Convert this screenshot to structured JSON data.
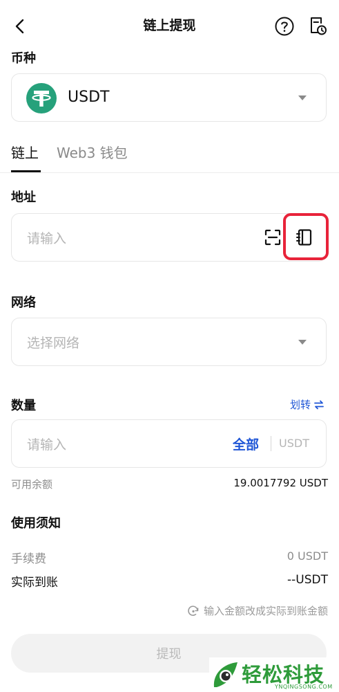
{
  "header": {
    "title": "链上提现"
  },
  "coin": {
    "label": "币种",
    "selected": "USDT"
  },
  "tabs": [
    {
      "label": "链上"
    },
    {
      "label": "Web3 钱包"
    }
  ],
  "address": {
    "label": "地址",
    "placeholder": "请输入"
  },
  "network": {
    "label": "网络",
    "placeholder": "选择网络"
  },
  "amount": {
    "label": "数量",
    "transfer_label": "划转",
    "placeholder": "请输入",
    "all_label": "全部",
    "unit": "USDT",
    "available_label": "可用余额",
    "available_value": "19.0017792 USDT"
  },
  "notice": {
    "title": "使用须知",
    "fee_label": "手续费",
    "fee_value": "0 USDT",
    "received_label": "实际到账",
    "received_value": "--USDT",
    "switch_hint": "输入金额改成实际到账金额"
  },
  "submit": {
    "label": "提现"
  },
  "watermark": {
    "brand": "轻松科技",
    "domain": "YNQINGSONG.COM"
  },
  "colors": {
    "accent": "#1f56d6",
    "highlight": "#e8233a",
    "tether": "#26a17b"
  }
}
